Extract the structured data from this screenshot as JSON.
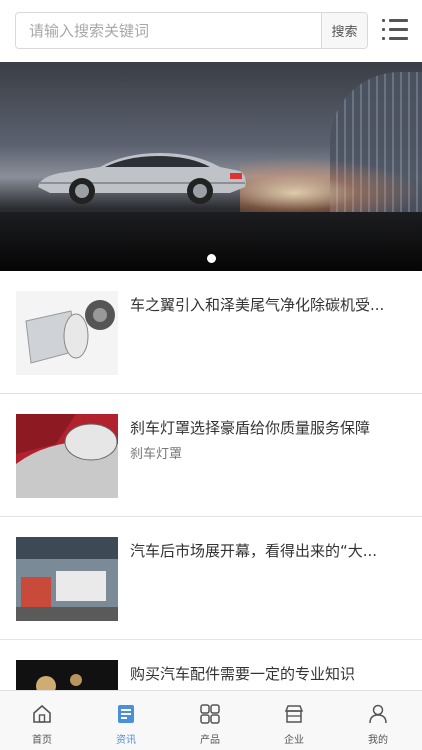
{
  "search": {
    "placeholder": "请输入搜索关键词",
    "button_label": "搜索"
  },
  "banner": {
    "slide_count": 1,
    "active_slide": 1
  },
  "news": [
    {
      "title": "车之翼引入和泽美尾气净化除碳机受...",
      "tag": ""
    },
    {
      "title": "刹车灯罩选择豪盾给你质量服务保障",
      "tag": "刹车灯罩"
    },
    {
      "title": "汽车后市场展开幕，看得出来的“大...",
      "tag": ""
    },
    {
      "title": "购买汽车配件需要一定的专业知识",
      "tag": ""
    }
  ],
  "tabbar": {
    "items": [
      {
        "label": "首页",
        "icon": "home-icon"
      },
      {
        "label": "资讯",
        "icon": "news-icon"
      },
      {
        "label": "产品",
        "icon": "grid-icon"
      },
      {
        "label": "企业",
        "icon": "store-icon"
      },
      {
        "label": "我的",
        "icon": "user-icon"
      }
    ],
    "active_index": 1
  },
  "colors": {
    "accent": "#4a90d9",
    "border": "#e3e3e3",
    "text": "#333333"
  }
}
